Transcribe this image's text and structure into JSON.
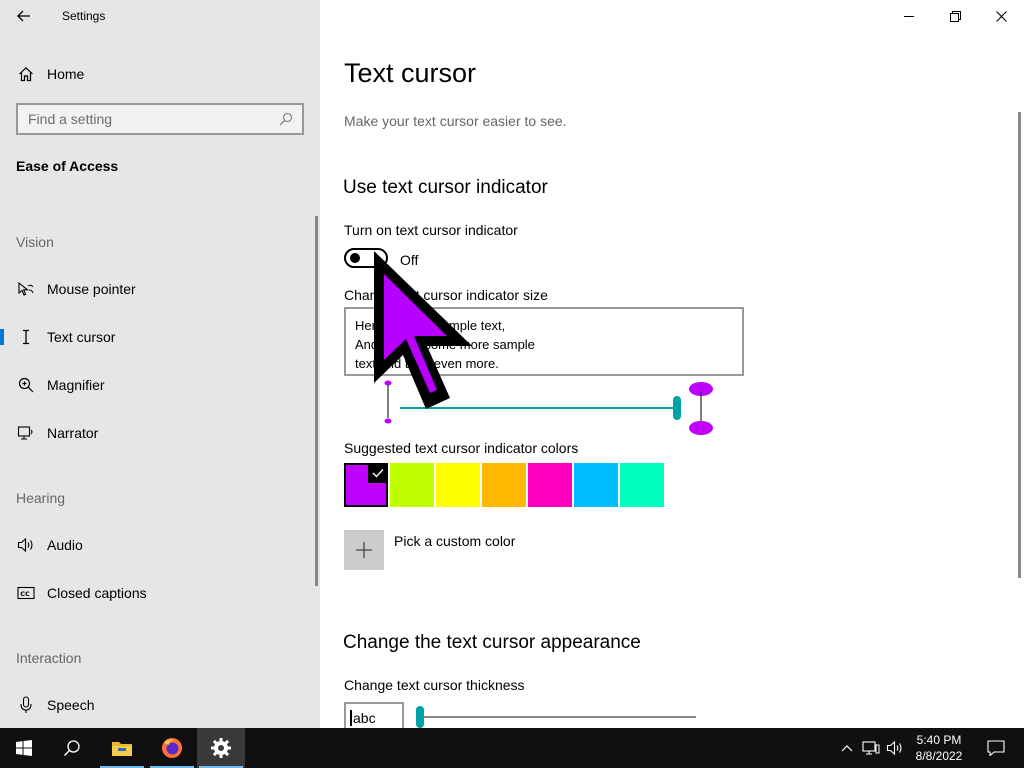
{
  "app": {
    "title": "Settings"
  },
  "sidebar": {
    "home_label": "Home",
    "search_placeholder": "Find a setting",
    "current_section": "Ease of Access",
    "groups": {
      "vision": "Vision",
      "hearing": "Hearing",
      "interaction": "Interaction"
    },
    "items": {
      "mouse_pointer": "Mouse pointer",
      "text_cursor": "Text cursor",
      "magnifier": "Magnifier",
      "narrator": "Narrator",
      "audio": "Audio",
      "closed_captions": "Closed captions",
      "speech": "Speech"
    },
    "selected_item": "Text cursor"
  },
  "main": {
    "title": "Text cursor",
    "subtitle": "Make your text cursor easier to see.",
    "indicator_section": {
      "heading": "Use text cursor indicator",
      "toggle_label": "Turn on text cursor indicator",
      "toggle_state": "Off",
      "size_label": "Change text cursor indicator size",
      "preview_lines": [
        "Here is some sample text,",
        "And here is some more sample",
        "text and then even more."
      ],
      "colors_label": "Suggested text cursor indicator colors",
      "colors": [
        "#bf00ff",
        "#bfff00",
        "#ffff00",
        "#ffb700",
        "#ff00bf",
        "#00bfff",
        "#00ffbf"
      ],
      "selected_color": "#bf00ff",
      "custom_color_label": "Pick a custom color"
    },
    "appearance_section": {
      "heading": "Change the text cursor appearance",
      "thickness_label": "Change text cursor thickness",
      "thickness_preview": "abc"
    }
  },
  "taskbar": {
    "time": "5:40 PM",
    "date": "8/8/2022",
    "accent": "#76b9ed"
  }
}
